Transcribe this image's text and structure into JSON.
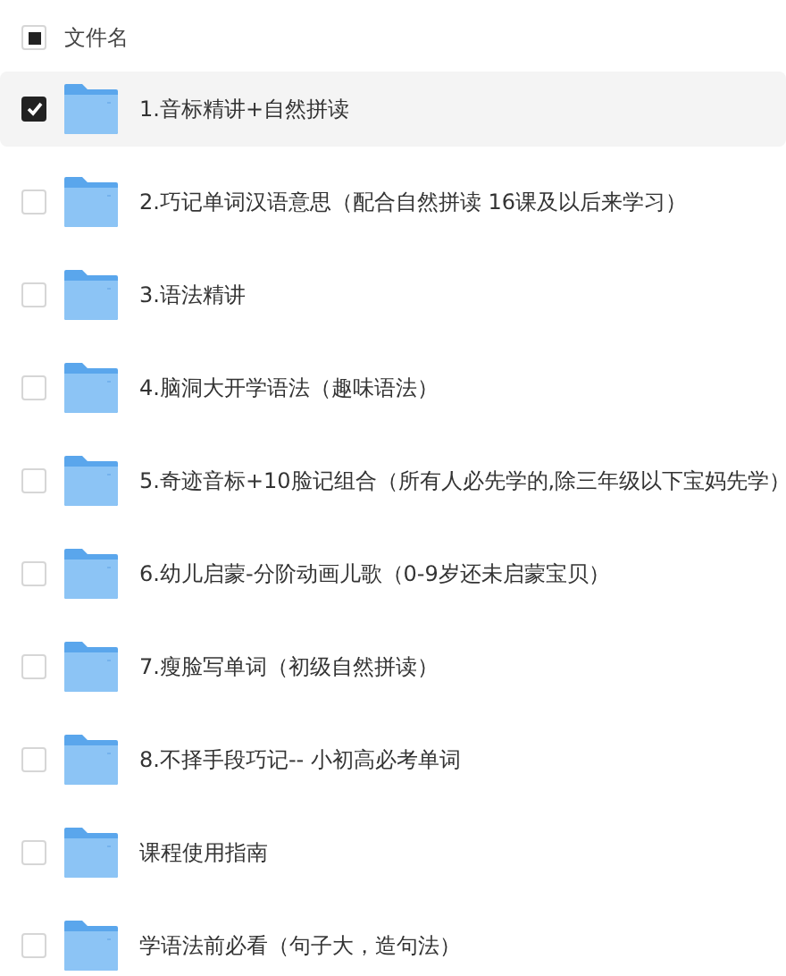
{
  "header": {
    "label": "文件名",
    "indeterminate": true
  },
  "files": [
    {
      "name": "1.音标精讲+自然拼读",
      "selected": true
    },
    {
      "name": "2.巧记单词汉语意思（配合自然拼读 16课及以后来学习）",
      "selected": false
    },
    {
      "name": "3.语法精讲",
      "selected": false
    },
    {
      "name": "4.脑洞大开学语法（趣味语法）",
      "selected": false
    },
    {
      "name": "5.奇迹音标+10脸记组合（所有人必先学的,除三年级以下宝妈先学）",
      "selected": false
    },
    {
      "name": "6.幼儿启蒙-分阶动画儿歌（0-9岁还未启蒙宝贝）",
      "selected": false
    },
    {
      "name": "7.瘦脸写单词（初级自然拼读）",
      "selected": false
    },
    {
      "name": "8.不择手段巧记-- 小初高必考单词",
      "selected": false
    },
    {
      "name": "课程使用指南",
      "selected": false
    },
    {
      "name": "学语法前必看（句子大，造句法）",
      "selected": false
    }
  ]
}
